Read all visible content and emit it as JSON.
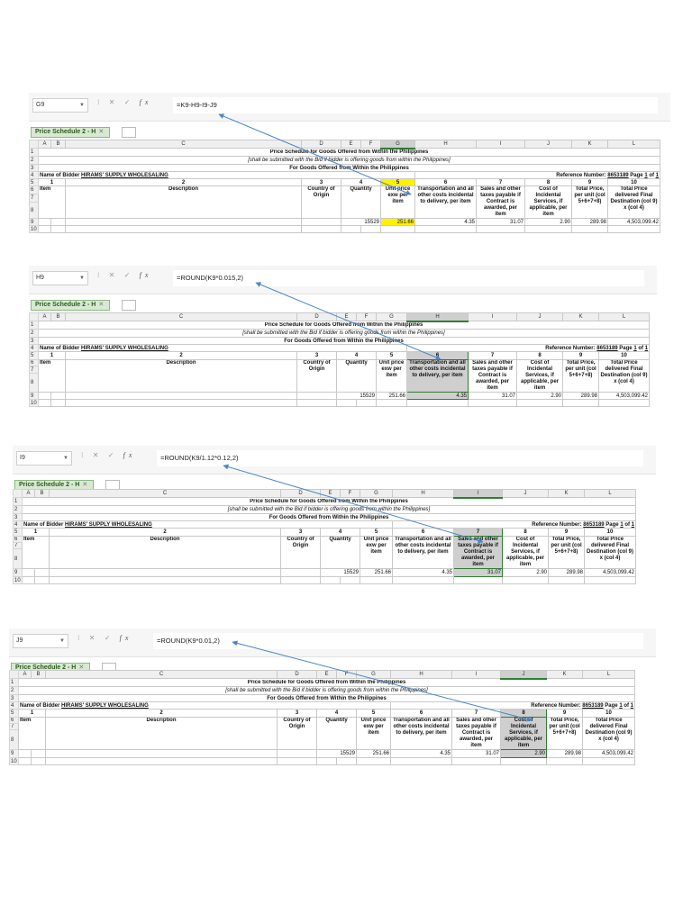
{
  "panels": [
    {
      "cell_ref": "G9",
      "formula": "=K9-H9-I9-J9",
      "highlight_col": "G",
      "highlight_style": "yellow"
    },
    {
      "cell_ref": "H9",
      "formula": "=ROUND(K9*0.015,2)",
      "highlight_col": "H",
      "highlight_style": "gray"
    },
    {
      "cell_ref": "I9",
      "formula": "=ROUND(K9/1.12*0.12,2)",
      "highlight_col": "I",
      "highlight_style": "gray"
    },
    {
      "cell_ref": "J9",
      "formula": "=ROUND(K9*0.01,2)",
      "highlight_col": "J",
      "highlight_style": "gray"
    }
  ],
  "sheet": {
    "tab_name": "Price Schedule 2 - H",
    "columns": [
      "A",
      "B",
      "C",
      "D",
      "E",
      "F",
      "G",
      "H",
      "I",
      "J",
      "K",
      "L"
    ],
    "rows": [
      "1",
      "2",
      "3",
      "4",
      "5",
      "6",
      "7",
      "8",
      "9",
      "10"
    ],
    "title": "Price Schedule for Goods Offered from Within the Philippines",
    "subtitle": "[shall be submitted with the Bid if bidder is offering goods from within the Philippines]",
    "goods_line": "For Goods Offered from Within the Philippines",
    "bidder_label": "Name of Bidder",
    "bidder_name": "HIRAMS' SUPPLY WHOLESALING",
    "reference_label": "Reference Number:",
    "reference_number": "8653189",
    "page_label": "Page",
    "page_num": "1",
    "page_of": "of",
    "page_total": "1",
    "col_numbers": [
      "1",
      "2",
      "3",
      "4",
      "5",
      "6",
      "7",
      "8",
      "9",
      "10"
    ],
    "headers": {
      "item": "Item",
      "description": "Description",
      "country": "Country of Origin",
      "quantity": "Quantity",
      "unit_price": "Unit price exw per item",
      "transport": "Transportation and all other costs incidental to delivery, per item",
      "sales_tax": "Sales and other taxes payable if Contract is awarded, per item",
      "incidental": "Cost of Incidental Services, if applicable, per item",
      "total_unit": "Total Price, per unit (col 5+6+7+8)",
      "total_delivered": "Total Price delivered Final Destination (col 9) x (col 4)"
    },
    "row9": {
      "quantity": "15529",
      "unit_price": "251.66",
      "transport": "4.35",
      "sales_tax": "31.07",
      "incidental": "2.90",
      "total_unit": "289.98",
      "total_delivered": "4,503,099.42"
    }
  },
  "colors": {
    "highlight_yellow": "#fff200",
    "highlight_gray": "#cfcfcf",
    "tab_green": "#d8e9d2",
    "arrow_blue": "#4a86c5"
  }
}
